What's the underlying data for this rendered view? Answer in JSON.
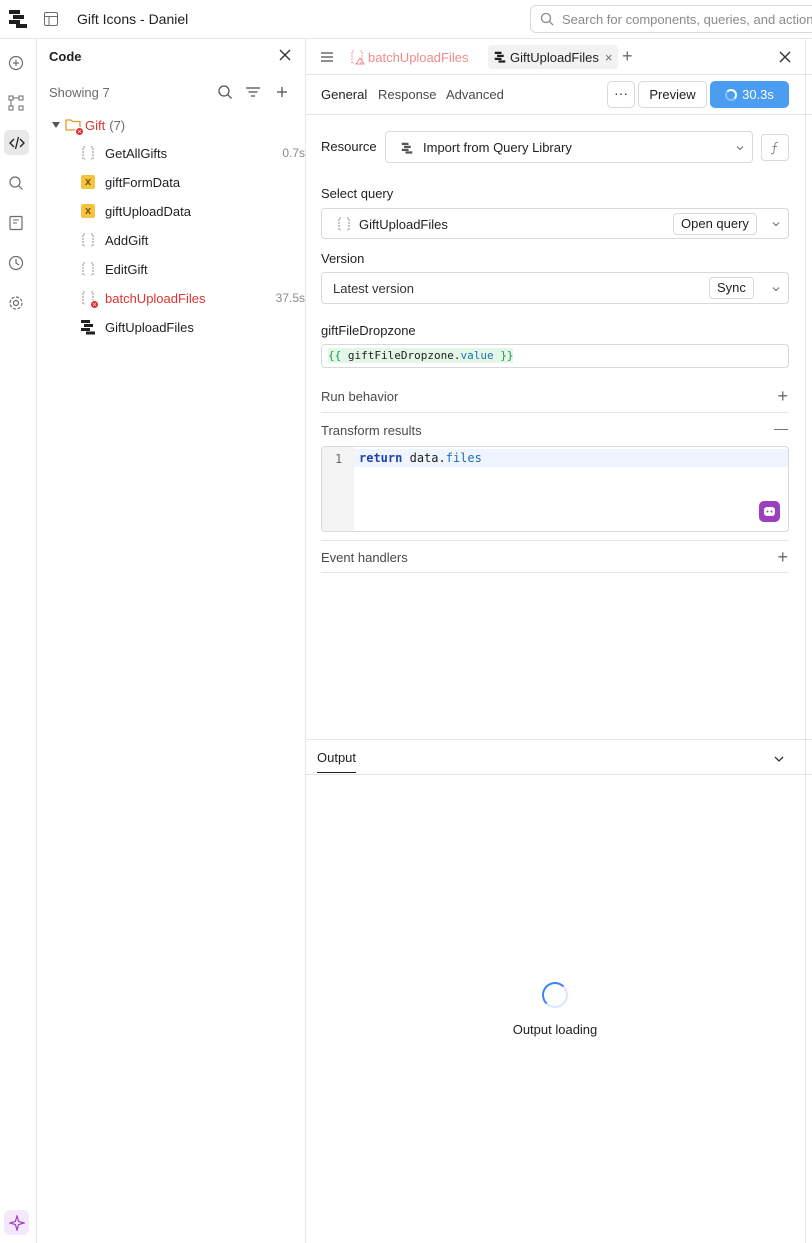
{
  "topbar": {
    "app_title": "Gift Icons - Daniel",
    "search_placeholder": "Search for components, queries, and actions"
  },
  "rail": {
    "items": [
      "add-icon",
      "components-icon",
      "code-icon",
      "search-icon",
      "state-icon",
      "history-icon",
      "settings-icon",
      "assist-icon"
    ]
  },
  "code_panel": {
    "title": "Code",
    "showing": "Showing 7",
    "folder": {
      "name": "Gift",
      "count": "(7)"
    },
    "queries": [
      {
        "name": "GetAllGifts",
        "time": "0.7s",
        "icon": "query-icon"
      },
      {
        "name": "giftFormData",
        "time": "",
        "icon": "variable-icon"
      },
      {
        "name": "giftUploadData",
        "time": "",
        "icon": "variable-icon"
      },
      {
        "name": "AddGift",
        "time": "",
        "icon": "query-icon"
      },
      {
        "name": "EditGift",
        "time": "",
        "icon": "query-icon"
      },
      {
        "name": "batchUploadFiles",
        "time": "37.5s",
        "icon": "query-error-icon"
      },
      {
        "name": "GiftUploadFiles",
        "time": "",
        "icon": "library-query-icon"
      }
    ]
  },
  "editor": {
    "tabs": [
      {
        "label": "batchUploadFiles"
      },
      {
        "label": "GiftUploadFiles",
        "close": "×"
      }
    ],
    "add_tab": "+",
    "subtabs": [
      "General",
      "Response",
      "Advanced"
    ],
    "more_label": "···",
    "preview_label": "Preview",
    "run_label": "30.3s",
    "resource": {
      "label": "Resource",
      "value": "Import from Query Library"
    },
    "select_query": {
      "label": "Select query",
      "value": "GiftUploadFiles",
      "open_label": "Open query"
    },
    "version": {
      "label": "Version",
      "value": "Latest version",
      "sync_label": "Sync"
    },
    "param": {
      "label": "giftFileDropzone",
      "open": "{{",
      "ident": "giftFileDropzone",
      "dot": ".",
      "prop": "value",
      "close": "}}"
    },
    "run_behavior": {
      "label": "Run behavior",
      "toggle": "+"
    },
    "transform": {
      "label": "Transform results",
      "toggle": "—",
      "line_number": "1",
      "keyword": "return",
      "object": "data",
      "dot": ".",
      "property": "files"
    },
    "event_handlers": {
      "label": "Event handlers",
      "toggle": "+"
    },
    "output": {
      "tab": "Output",
      "loading": "Output loading"
    }
  },
  "colors": {
    "error": "#dd3333",
    "run_button": "#4a9df0",
    "variable": "#f5c342",
    "assist": "#9b3fbf"
  }
}
